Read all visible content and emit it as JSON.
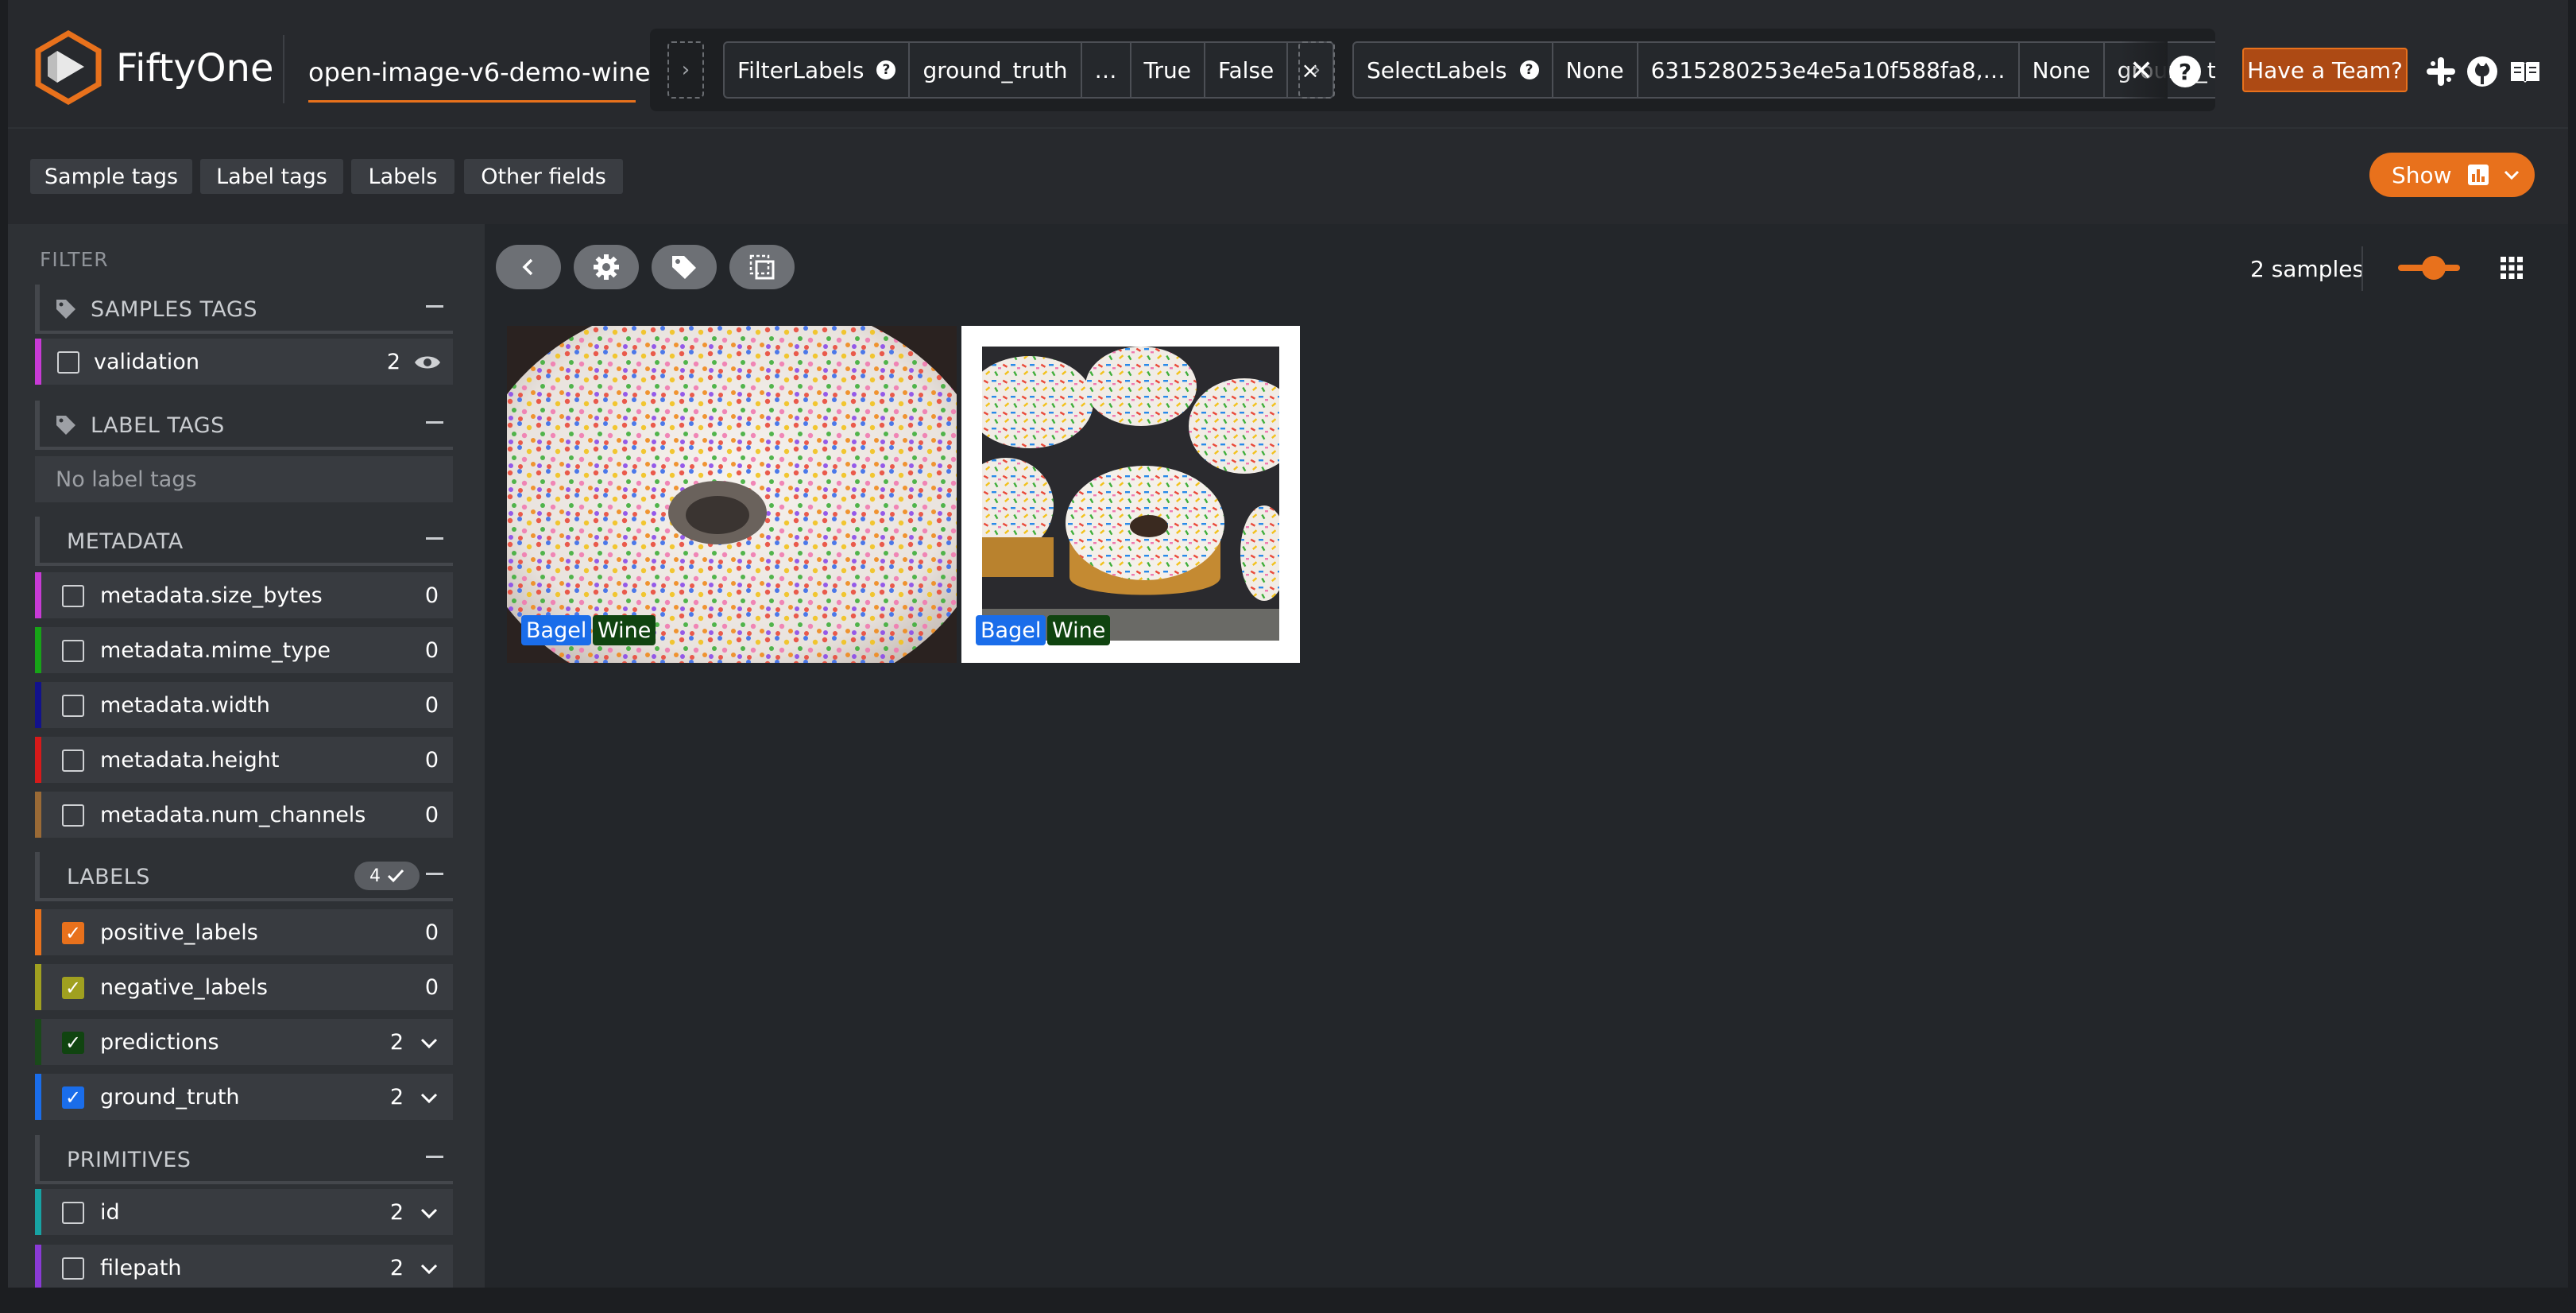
{
  "app": {
    "brand": "FiftyOne",
    "dataset": "open-image-v6-demo-wine"
  },
  "view_stages": {
    "stage1": {
      "name": "FilterLabels",
      "field": "ground_truth",
      "more": "…",
      "opt_true": "True",
      "opt_false": "False",
      "close": "×"
    },
    "stage2": {
      "name": "SelectLabels",
      "v1": "None",
      "v2": "6315280253e4e5a10f588fa8,…",
      "v3": "None",
      "v4": "ground_truth",
      "v4_fade": "re"
    },
    "close": "✕",
    "help": "?"
  },
  "header_actions": {
    "team_button": "Have a Team?",
    "icons": [
      "slack-icon",
      "github-icon",
      "docs-icon"
    ]
  },
  "field_tabs": [
    "Sample tags",
    "Label tags",
    "Labels",
    "Other fields"
  ],
  "show_button": "Show",
  "sidebar": {
    "filter_title": "FILTER",
    "sample_tags": {
      "title": "SAMPLES TAGS",
      "items": [
        {
          "label": "validation",
          "count": "2"
        }
      ]
    },
    "label_tags": {
      "title": "LABEL TAGS",
      "empty": "No label tags"
    },
    "metadata": {
      "title": "METADATA",
      "items": [
        {
          "label": "metadata.size_bytes",
          "count": "0",
          "color": "#c83ad6"
        },
        {
          "label": "metadata.mime_type",
          "count": "0",
          "color": "#17a317"
        },
        {
          "label": "metadata.width",
          "count": "0",
          "color": "#12128c"
        },
        {
          "label": "metadata.height",
          "count": "0",
          "color": "#d61a1a"
        },
        {
          "label": "metadata.num_channels",
          "count": "0",
          "color": "#9a6a36"
        }
      ]
    },
    "labels": {
      "title": "LABELS",
      "badge": "4",
      "items": [
        {
          "label": "positive_labels",
          "count": "0",
          "color": "#e8711c",
          "checked": true
        },
        {
          "label": "negative_labels",
          "count": "0",
          "color": "#a0a020",
          "checked": true
        },
        {
          "label": "predictions",
          "count": "2",
          "color": "#1a4a1a",
          "checked": true
        },
        {
          "label": "ground_truth",
          "count": "2",
          "color": "#1a6dea",
          "checked": true
        }
      ]
    },
    "primitives": {
      "title": "PRIMITIVES",
      "items": [
        {
          "label": "id",
          "count": "2",
          "color": "#17a3a3"
        },
        {
          "label": "filepath",
          "count": "2",
          "color": "#8a3ad6"
        }
      ]
    }
  },
  "grid": {
    "samples_count": "2 samples",
    "samples": [
      {
        "tags": [
          "Bagel",
          "Wine"
        ]
      },
      {
        "tags": [
          "Bagel",
          "Wine"
        ]
      }
    ]
  },
  "colors": {
    "accent": "#e8711c",
    "background": "#23262a",
    "ground_truth": "#1a6dea",
    "predictions": "#104410"
  }
}
